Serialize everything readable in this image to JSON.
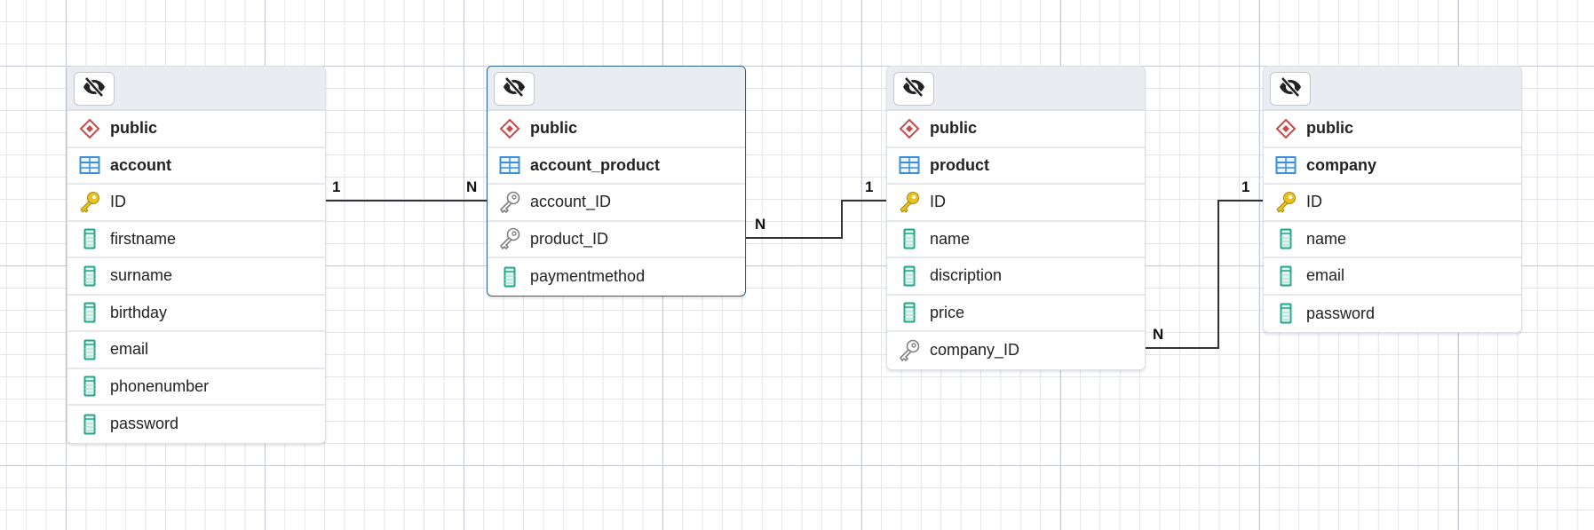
{
  "tables": [
    {
      "schema": "public",
      "name": "account",
      "selected": false,
      "columns": [
        {
          "name": "ID",
          "icon": "primary-key"
        },
        {
          "name": "firstname",
          "icon": "column"
        },
        {
          "name": "surname",
          "icon": "column"
        },
        {
          "name": "birthday",
          "icon": "column"
        },
        {
          "name": "email",
          "icon": "column"
        },
        {
          "name": "phonenumber",
          "icon": "column"
        },
        {
          "name": "password",
          "icon": "column"
        }
      ]
    },
    {
      "schema": "public",
      "name": "account_product",
      "selected": true,
      "columns": [
        {
          "name": "account_ID",
          "icon": "foreign-key"
        },
        {
          "name": "product_ID",
          "icon": "foreign-key"
        },
        {
          "name": "paymentmethod",
          "icon": "column"
        }
      ]
    },
    {
      "schema": "public",
      "name": "product",
      "selected": false,
      "columns": [
        {
          "name": "ID",
          "icon": "primary-key"
        },
        {
          "name": "name",
          "icon": "column"
        },
        {
          "name": "discription",
          "icon": "column"
        },
        {
          "name": "price",
          "icon": "column"
        },
        {
          "name": "company_ID",
          "icon": "foreign-key"
        }
      ]
    },
    {
      "schema": "public",
      "name": "company",
      "selected": false,
      "columns": [
        {
          "name": "ID",
          "icon": "primary-key"
        },
        {
          "name": "name",
          "icon": "column"
        },
        {
          "name": "email",
          "icon": "column"
        },
        {
          "name": "password",
          "icon": "column"
        }
      ]
    }
  ],
  "relationships": [
    {
      "from": "account.ID",
      "to": "account_product.account_ID",
      "from_card": "1",
      "to_card": "N"
    },
    {
      "from": "account_product.product_ID",
      "to": "product.ID",
      "from_card": "N",
      "to_card": "1"
    },
    {
      "from": "product.company_ID",
      "to": "company.ID",
      "from_card": "N",
      "to_card": "1"
    }
  ],
  "colors": {
    "schema": "#c94a4a",
    "table": "#3b8fd9",
    "primary_key": "#e8c21e",
    "foreign_key": "#808080",
    "column": "#22a58a",
    "selected_border": "#2c5f8e"
  }
}
